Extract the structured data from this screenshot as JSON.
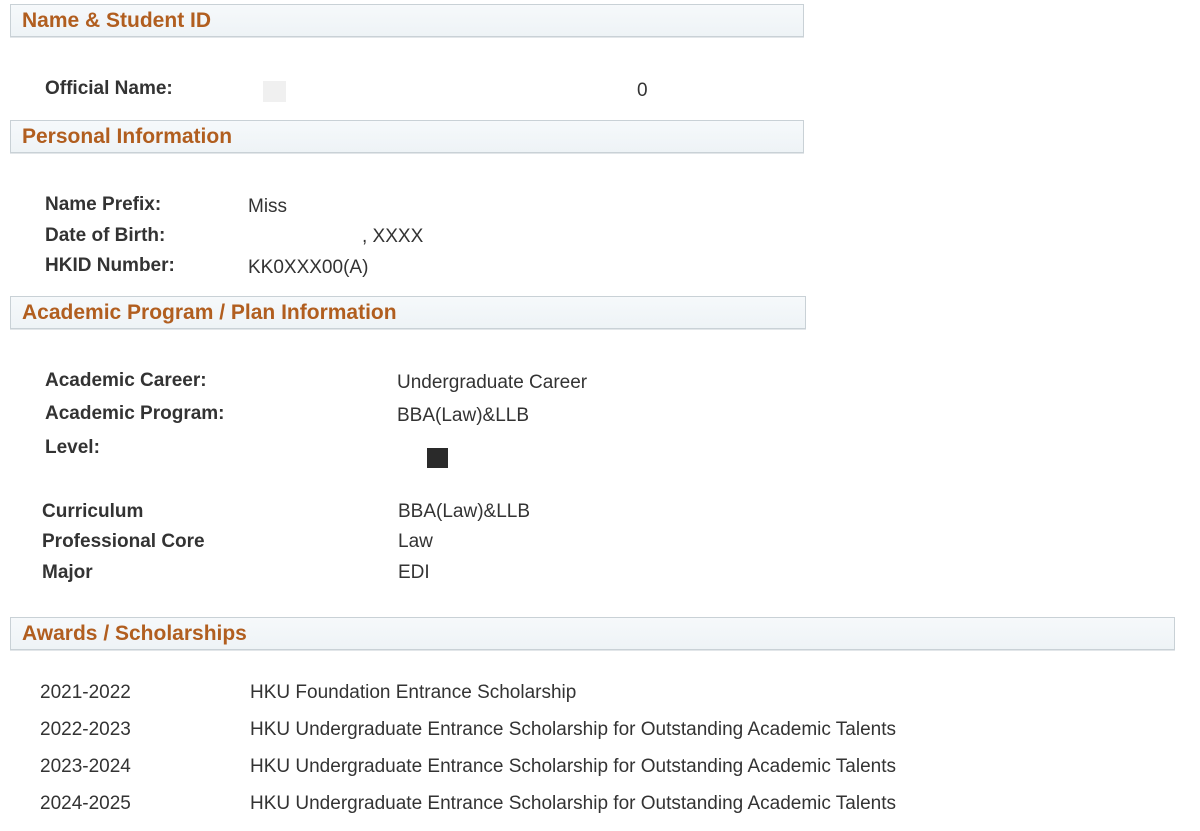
{
  "sections": {
    "name_id": {
      "title": "Name & Student ID"
    },
    "personal": {
      "title": "Personal Information"
    },
    "academic": {
      "title": "Academic Program / Plan Information"
    },
    "awards": {
      "title": "Awards / Scholarships"
    }
  },
  "name_id": {
    "official_name_label": "Official Name:",
    "official_name_tail": "0"
  },
  "personal": {
    "prefix_label": "Name Prefix:",
    "prefix_value": "Miss",
    "dob_label": "Date of Birth:",
    "dob_value": ", XXXX",
    "hkid_label": "HKID Number:",
    "hkid_value": "KK0XXX00(A)"
  },
  "academic": {
    "career_label": "Academic Career:",
    "career_value": "Undergraduate Career",
    "program_label": "Academic Program:",
    "program_value": "BBA(Law)&LLB",
    "level_label": "Level:",
    "curriculum_label": "Curriculum",
    "curriculum_value": "BBA(Law)&LLB",
    "core_label": "Professional Core",
    "core_value": "Law",
    "major_label": "Major",
    "major_value": "EDI"
  },
  "awards": {
    "rows": [
      {
        "year": "2021-2022",
        "award": "HKU Foundation Entrance Scholarship"
      },
      {
        "year": "2022-2023",
        "award": "HKU Undergraduate Entrance Scholarship for Outstanding Academic Talents"
      },
      {
        "year": "2023-2024",
        "award": "HKU Undergraduate Entrance Scholarship for Outstanding Academic Talents"
      },
      {
        "year": "2024-2025",
        "award": "HKU Undergraduate Entrance Scholarship for Outstanding Academic Talents"
      }
    ]
  },
  "colors": {
    "header_text": "#b15e1f",
    "header_border": "#c9d1d6",
    "body_text": "#333333"
  }
}
